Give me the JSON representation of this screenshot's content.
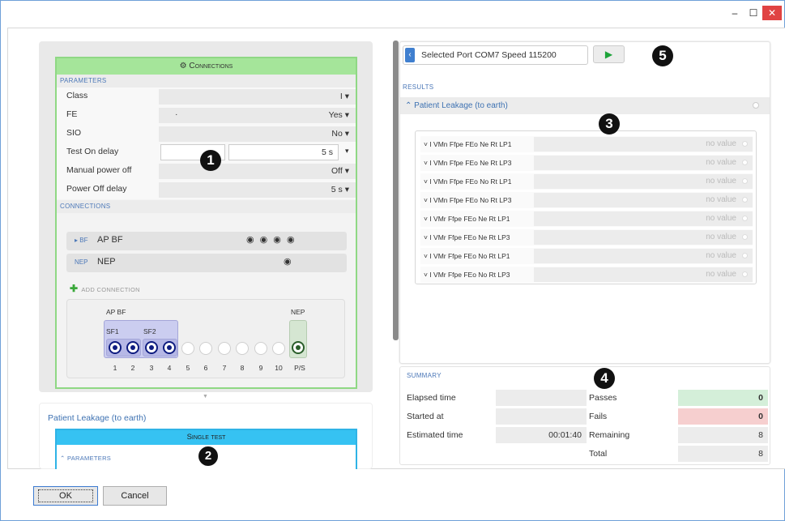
{
  "window": {
    "minimize": "–",
    "maximize": "☐",
    "close": "✕"
  },
  "connections_panel": {
    "header": "⚙ Connections",
    "parameters_label": "PARAMETERS",
    "params": [
      {
        "label": "Class",
        "value": "I ▾"
      },
      {
        "label": "FE",
        "value": "Yes ▾",
        "dot": "·"
      },
      {
        "label": "SIO",
        "value": "No ▾"
      },
      {
        "label": "Test On delay",
        "value": "5 s",
        "arrow": "▾"
      },
      {
        "label": "Manual power off",
        "value": "Off ▾"
      },
      {
        "label": "Power Off delay",
        "value": "5 s ▾"
      }
    ],
    "connections_label": "CONNECTIONS",
    "rows": [
      {
        "tag": "▸ BF",
        "name": "AP BF",
        "dots": "◉ ◉ ◉ ◉"
      },
      {
        "tag": "NEP",
        "name": "NEP",
        "dots": "◉"
      }
    ],
    "add_connection": "ADD CONNECTION",
    "diagram": {
      "group_ap": "AP BF",
      "group_nep": "NEP",
      "sf1": "SF1",
      "sf2": "SF2",
      "numbers": [
        "1",
        "2",
        "3",
        "4",
        "5",
        "6",
        "7",
        "8",
        "9",
        "10",
        "P/S"
      ]
    }
  },
  "test_panel": {
    "title": "Patient Leakage (to earth)",
    "single_test": "Single test",
    "parameters": "⌃  PARAMETERS"
  },
  "markers": [
    "1",
    "2",
    "3",
    "4",
    "5"
  ],
  "port": {
    "back": "‹",
    "text": "Selected Port  COM7   Speed  115200",
    "play": "▶"
  },
  "results": {
    "label": "RESULTS",
    "group": "⌃ Patient Leakage (to earth)",
    "rows": [
      {
        "name": "˅ I  VMn Ffpe FEo Ne Rt LP1",
        "value": "no value"
      },
      {
        "name": "˅ I  VMn Ffpe FEo Ne Rt LP3",
        "value": "no value"
      },
      {
        "name": "˅ I  VMn Ffpe FEo No Rt LP1",
        "value": "no value"
      },
      {
        "name": "˅ I  VMn Ffpe FEo No Rt LP3",
        "value": "no value"
      },
      {
        "name": "˅ I  VMr Ffpe FEo Ne Rt LP1",
        "value": "no value"
      },
      {
        "name": "˅ I  VMr Ffpe FEo Ne Rt LP3",
        "value": "no value"
      },
      {
        "name": "˅ I  VMr Ffpe FEo No Rt LP1",
        "value": "no value"
      },
      {
        "name": "˅ I  VMr Ffpe FEo No Rt LP3",
        "value": "no value"
      }
    ]
  },
  "summary": {
    "label": "SUMMARY",
    "elapsed_label": "Elapsed time",
    "elapsed_value": "",
    "started_label": "Started at",
    "started_value": "",
    "estimated_label": "Estimated time",
    "estimated_value": "00:01:40",
    "passes_label": "Passes",
    "passes_value": "0",
    "fails_label": "Fails",
    "fails_value": "0",
    "remaining_label": "Remaining",
    "remaining_value": "8",
    "total_label": "Total",
    "total_value": "8",
    "passes_color": "#d4efd9",
    "fails_color": "#f6cfcf"
  },
  "buttons": {
    "ok": "OK",
    "cancel": "Cancel"
  }
}
